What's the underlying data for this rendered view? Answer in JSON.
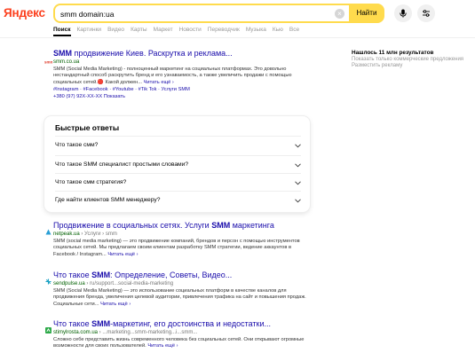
{
  "header": {
    "logo": "Яндекс",
    "search_value": "smm domain:ua",
    "clear_glyph": "×",
    "find_label": "Найти",
    "mic_icon": "microphone-icon",
    "filter_icon": "sliders-icon"
  },
  "tabs": [
    "Поиск",
    "Картинки",
    "Видео",
    "Карты",
    "Маркет",
    "Новости",
    "Переводчик",
    "Музыка",
    "Кью",
    "Все"
  ],
  "right": {
    "found": "Нашлось 11 млн результатов",
    "link1": "Показать только коммерческие предложения",
    "link2": "Разместить рекламу"
  },
  "results": [
    {
      "title_bold": "SMM",
      "title_rest": " продвижение Киев. Раскрутка и реклама...",
      "url": "smm.co.ua",
      "url_path": "",
      "snippet": "SMM (Social Media Marketing) - полноценный маркетинг на социальных платформах. Это довольно нестандартный способ раскрутить бренд и его узнаваемость, а также увеличить продажи с помощью социальных сетей.🔴 Какой должен...",
      "more": "Читать ещё ›",
      "tags": "#Instagram · #Facebook · #Youtube · #Tik Tok · Услуги SMM",
      "phone": "+380 (97) 92X-XX-XX Показать"
    },
    {
      "title_pre": "Продвижение в социальных сетях. Услуги ",
      "title_bold": "SMM",
      "title_rest": " маркетинга",
      "url": "netpeak.ua",
      "url_path": " › Услуги › smm",
      "snippet": "SMM (social media marketing) — это продвижение компаний, брендов и персон с помощью инструментов социальных сетей. Мы предлагаем своим клиентам разработку SMM стратегии, ведение аккаунтов в Facebook / Instagram...",
      "more": "Читать ещё ›"
    },
    {
      "title_pre": "Что такое ",
      "title_bold": "SMM",
      "title_rest": ": Определение, Советы, Видео...",
      "url": "sendpulse.ua",
      "url_path": " › ru/support...social-media-marketing",
      "snippet": "SMM (Social Media Marketing) — это использование социальных платформ в качестве каналов для продвижения бренда, увеличения целевой аудитории, привлечения трафика на сайт и повышения продаж. Социальные сети...",
      "more": "Читать ещё ›"
    },
    {
      "title_pre": "Что такое ",
      "title_bold": "SMM",
      "title_rest": "-маркетинг, его достоинства и недостатки...",
      "url": "stimylrosta.com.ua",
      "url_path": " › ...marketing...smm-marketing...i...smm...",
      "snippet": "Сложно себе представить жизнь современного человека без социальных сетей. Они открывают огромные возможности для своих пользователей.",
      "more": "Читать ещё ›"
    }
  ],
  "faq": {
    "title": "Быстрые ответы",
    "items": [
      "Что такое смм?",
      "Что такое SMM специалист простыми словами?",
      "Что такое смм стратегия?",
      "Где найти клиентов SMM менеджеру?"
    ]
  }
}
